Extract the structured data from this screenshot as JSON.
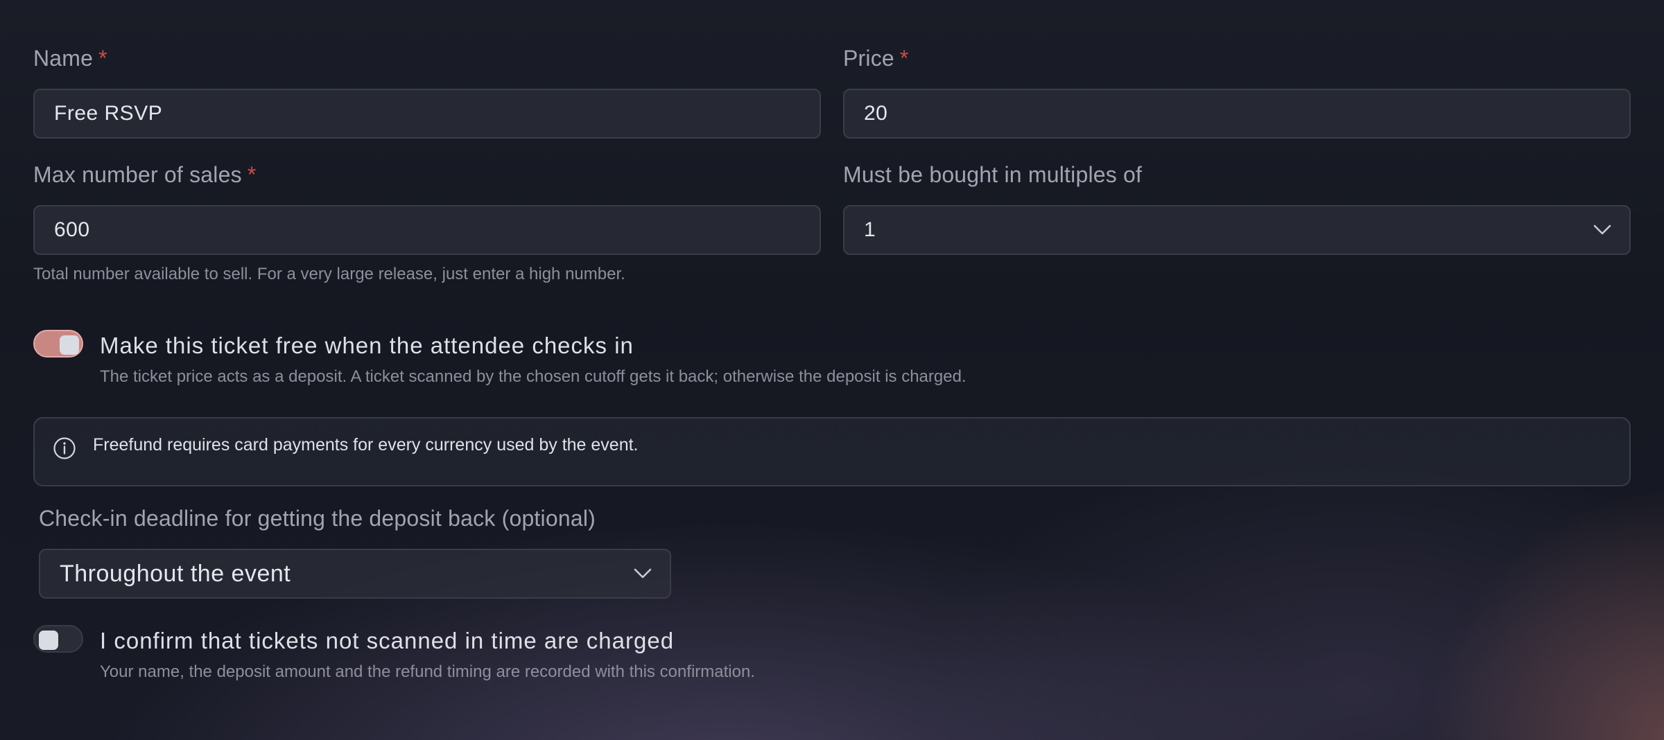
{
  "form": {
    "name": {
      "label": "Name",
      "required_mark": "*",
      "value": "Free RSVP"
    },
    "price": {
      "label": "Price",
      "required_mark": "*",
      "value": "20"
    },
    "max_sales": {
      "label": "Max number of sales",
      "required_mark": "*",
      "value": "600",
      "help": "Total number available to sell. For a very large release, just enter a high number."
    },
    "multiples": {
      "label": "Must be bought in multiples of",
      "value": "1",
      "icon": "chevron-down-icon"
    },
    "free_on_checkin": {
      "state": "on",
      "title": "Make this ticket free when the attendee checks in",
      "description": "The ticket price acts as a deposit. A ticket scanned by the chosen cutoff gets it back; otherwise the deposit is charged."
    },
    "notice": {
      "icon": "info-icon",
      "text": "Freefund requires card payments for every currency used by the event."
    },
    "deadline": {
      "label": "Check-in deadline for getting the deposit back (optional)",
      "value": "Throughout the event",
      "icon": "chevron-down-icon"
    },
    "confirm": {
      "state": "off",
      "title": "I confirm that tickets not scanned in time are charged",
      "description": "Your name, the deposit amount and the refund timing are recorded with this confirmation."
    }
  },
  "colors": {
    "required": "#d24a48",
    "toggle_on": "#c98784",
    "toggle_off": "#2a2d38",
    "input_border": "#3a3d49"
  }
}
